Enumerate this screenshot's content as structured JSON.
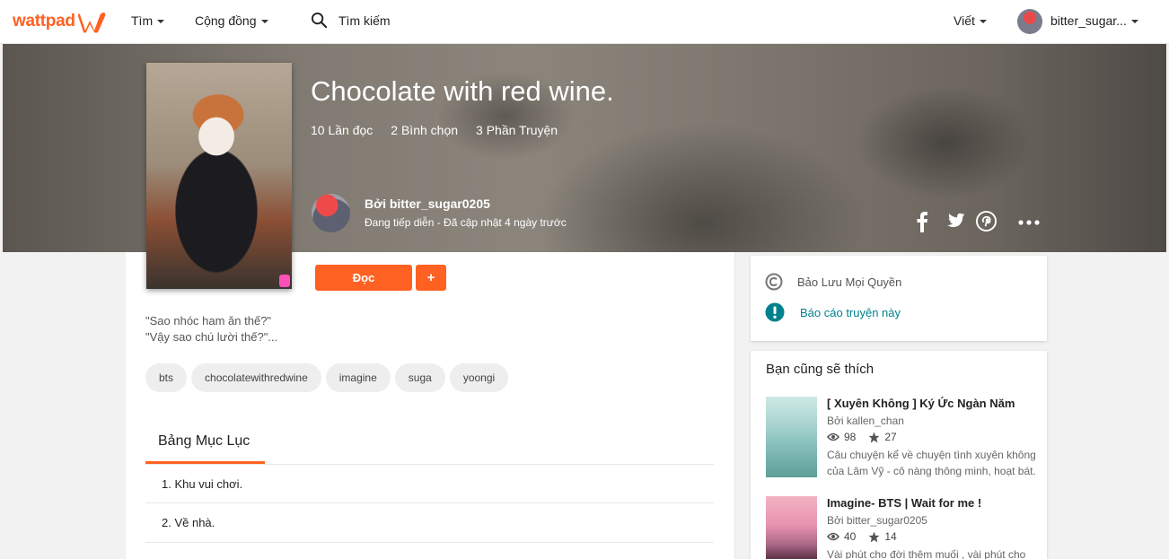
{
  "nav": {
    "logo_text": "wattpad",
    "discover": "Tìm",
    "community": "Cộng đồng",
    "search_placeholder": "Tìm kiếm",
    "write": "Viết",
    "username": "bitter_sugar..."
  },
  "story": {
    "title": "Chocolate with red wine.",
    "reads": "10 Lần đọc",
    "votes": "2 Bình chọn",
    "parts": "3 Phần Truyện",
    "author_line": "Bởi bitter_sugar0205",
    "status_line": "Đang tiếp diễn - Đã cập nhật 4 ngày trước",
    "read_button": "Đọc",
    "add_button": "+",
    "description": [
      "\"Sao nhóc ham ăn thế?\"",
      "\"Vậy sao chú lười thế?\"..."
    ],
    "tags": [
      "bts",
      "chocolatewithredwine",
      "imagine",
      "suga",
      "yoongi"
    ]
  },
  "toc": {
    "title": "Bảng Mục Lục",
    "items": [
      "1. Khu vui chơi.",
      "2. Về nhà."
    ]
  },
  "sidebar": {
    "copyright": "Bảo Lưu Mọi Quyền",
    "report": "Báo cáo truyện này",
    "recommend_title": "Bạn cũng sẽ thích",
    "recommendations": [
      {
        "title": "[ Xuyên Không ] Ký Ức Ngàn Năm",
        "author": "Bởi kallen_chan",
        "reads": "98",
        "votes": "27",
        "description": "Câu chuyện kể về chuyện tình xuyên không của Lâm Vỹ - cô nàng thông minh, hoạt bát."
      },
      {
        "title": "Imagine- BTS | Wait for me !",
        "author": "Bởi bitter_sugar0205",
        "reads": "40",
        "votes": "14",
        "description": "Vài phút cho đời thêm muối , vài phút cho"
      }
    ]
  },
  "colors": {
    "brand": "#ff6122",
    "link": "#00818e"
  }
}
